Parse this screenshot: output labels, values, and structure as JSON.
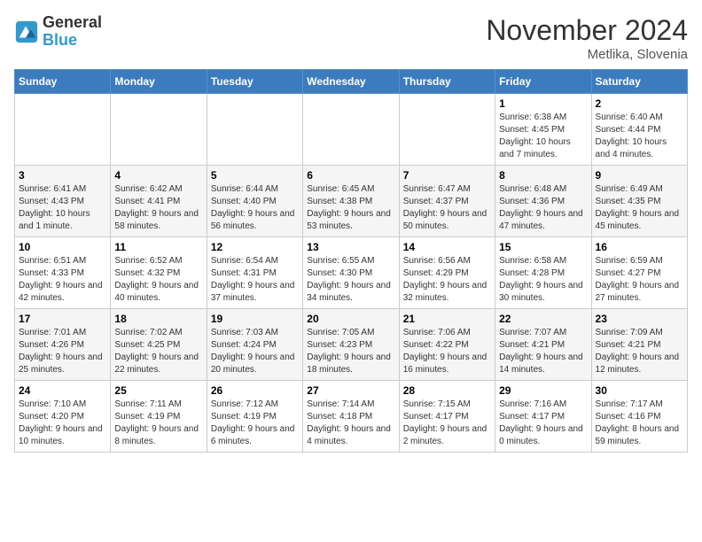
{
  "header": {
    "logo_general": "General",
    "logo_blue": "Blue",
    "month_title": "November 2024",
    "location": "Metlika, Slovenia"
  },
  "weekdays": [
    "Sunday",
    "Monday",
    "Tuesday",
    "Wednesday",
    "Thursday",
    "Friday",
    "Saturday"
  ],
  "weeks": [
    [
      {
        "day": "",
        "info": ""
      },
      {
        "day": "",
        "info": ""
      },
      {
        "day": "",
        "info": ""
      },
      {
        "day": "",
        "info": ""
      },
      {
        "day": "",
        "info": ""
      },
      {
        "day": "1",
        "info": "Sunrise: 6:38 AM\nSunset: 4:45 PM\nDaylight: 10 hours and 7 minutes."
      },
      {
        "day": "2",
        "info": "Sunrise: 6:40 AM\nSunset: 4:44 PM\nDaylight: 10 hours and 4 minutes."
      }
    ],
    [
      {
        "day": "3",
        "info": "Sunrise: 6:41 AM\nSunset: 4:43 PM\nDaylight: 10 hours and 1 minute."
      },
      {
        "day": "4",
        "info": "Sunrise: 6:42 AM\nSunset: 4:41 PM\nDaylight: 9 hours and 58 minutes."
      },
      {
        "day": "5",
        "info": "Sunrise: 6:44 AM\nSunset: 4:40 PM\nDaylight: 9 hours and 56 minutes."
      },
      {
        "day": "6",
        "info": "Sunrise: 6:45 AM\nSunset: 4:38 PM\nDaylight: 9 hours and 53 minutes."
      },
      {
        "day": "7",
        "info": "Sunrise: 6:47 AM\nSunset: 4:37 PM\nDaylight: 9 hours and 50 minutes."
      },
      {
        "day": "8",
        "info": "Sunrise: 6:48 AM\nSunset: 4:36 PM\nDaylight: 9 hours and 47 minutes."
      },
      {
        "day": "9",
        "info": "Sunrise: 6:49 AM\nSunset: 4:35 PM\nDaylight: 9 hours and 45 minutes."
      }
    ],
    [
      {
        "day": "10",
        "info": "Sunrise: 6:51 AM\nSunset: 4:33 PM\nDaylight: 9 hours and 42 minutes."
      },
      {
        "day": "11",
        "info": "Sunrise: 6:52 AM\nSunset: 4:32 PM\nDaylight: 9 hours and 40 minutes."
      },
      {
        "day": "12",
        "info": "Sunrise: 6:54 AM\nSunset: 4:31 PM\nDaylight: 9 hours and 37 minutes."
      },
      {
        "day": "13",
        "info": "Sunrise: 6:55 AM\nSunset: 4:30 PM\nDaylight: 9 hours and 34 minutes."
      },
      {
        "day": "14",
        "info": "Sunrise: 6:56 AM\nSunset: 4:29 PM\nDaylight: 9 hours and 32 minutes."
      },
      {
        "day": "15",
        "info": "Sunrise: 6:58 AM\nSunset: 4:28 PM\nDaylight: 9 hours and 30 minutes."
      },
      {
        "day": "16",
        "info": "Sunrise: 6:59 AM\nSunset: 4:27 PM\nDaylight: 9 hours and 27 minutes."
      }
    ],
    [
      {
        "day": "17",
        "info": "Sunrise: 7:01 AM\nSunset: 4:26 PM\nDaylight: 9 hours and 25 minutes."
      },
      {
        "day": "18",
        "info": "Sunrise: 7:02 AM\nSunset: 4:25 PM\nDaylight: 9 hours and 22 minutes."
      },
      {
        "day": "19",
        "info": "Sunrise: 7:03 AM\nSunset: 4:24 PM\nDaylight: 9 hours and 20 minutes."
      },
      {
        "day": "20",
        "info": "Sunrise: 7:05 AM\nSunset: 4:23 PM\nDaylight: 9 hours and 18 minutes."
      },
      {
        "day": "21",
        "info": "Sunrise: 7:06 AM\nSunset: 4:22 PM\nDaylight: 9 hours and 16 minutes."
      },
      {
        "day": "22",
        "info": "Sunrise: 7:07 AM\nSunset: 4:21 PM\nDaylight: 9 hours and 14 minutes."
      },
      {
        "day": "23",
        "info": "Sunrise: 7:09 AM\nSunset: 4:21 PM\nDaylight: 9 hours and 12 minutes."
      }
    ],
    [
      {
        "day": "24",
        "info": "Sunrise: 7:10 AM\nSunset: 4:20 PM\nDaylight: 9 hours and 10 minutes."
      },
      {
        "day": "25",
        "info": "Sunrise: 7:11 AM\nSunset: 4:19 PM\nDaylight: 9 hours and 8 minutes."
      },
      {
        "day": "26",
        "info": "Sunrise: 7:12 AM\nSunset: 4:19 PM\nDaylight: 9 hours and 6 minutes."
      },
      {
        "day": "27",
        "info": "Sunrise: 7:14 AM\nSunset: 4:18 PM\nDaylight: 9 hours and 4 minutes."
      },
      {
        "day": "28",
        "info": "Sunrise: 7:15 AM\nSunset: 4:17 PM\nDaylight: 9 hours and 2 minutes."
      },
      {
        "day": "29",
        "info": "Sunrise: 7:16 AM\nSunset: 4:17 PM\nDaylight: 9 hours and 0 minutes."
      },
      {
        "day": "30",
        "info": "Sunrise: 7:17 AM\nSunset: 4:16 PM\nDaylight: 8 hours and 59 minutes."
      }
    ]
  ]
}
